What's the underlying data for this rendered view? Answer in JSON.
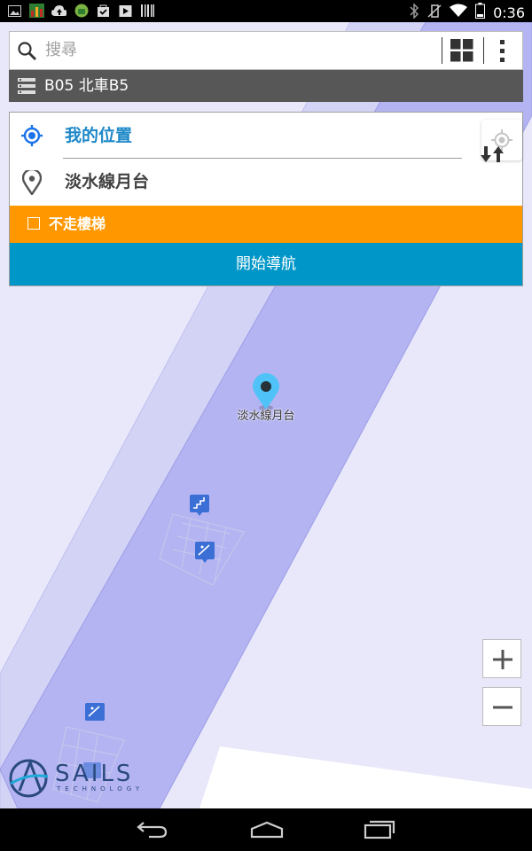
{
  "status_bar": {
    "time": "0:36",
    "left_icons": [
      "image-icon",
      "equalizer-icon",
      "cloud-upload-icon",
      "android-icon",
      "shopping-bag-icon",
      "play-store-icon",
      "barcode-icon"
    ],
    "right_icons": [
      "bluetooth-icon",
      "vibrate-off-icon",
      "wifi-icon",
      "battery-icon"
    ]
  },
  "search": {
    "placeholder": "搜尋",
    "icons": [
      "search-icon",
      "grid-icon",
      "more-vert-icon"
    ]
  },
  "floor": {
    "label": "B05 北車B5",
    "icon": "layers-icon"
  },
  "route": {
    "origin_label": "我的位置",
    "destination_label": "淡水線月台",
    "avoid_stairs_label": "不走樓梯",
    "avoid_stairs_checked": false,
    "start_button_label": "開始導航"
  },
  "map": {
    "poi_label": "淡水線月台",
    "colors": {
      "background": "#e8e8fa",
      "corridor_outer": "#d3d3f6",
      "corridor_inner": "#b4b4f2",
      "icon_blue": "#3b6fd6"
    }
  },
  "zoom": {
    "in_label": "+",
    "out_label": "−"
  },
  "colors": {
    "accent_blue": "#0097c8",
    "option_orange": "#ff9800",
    "floor_bar": "#575757",
    "origin_blue": "#1a73e8"
  },
  "logo": {
    "text": "SAILS",
    "subtext": "TECHNOLOGY"
  }
}
